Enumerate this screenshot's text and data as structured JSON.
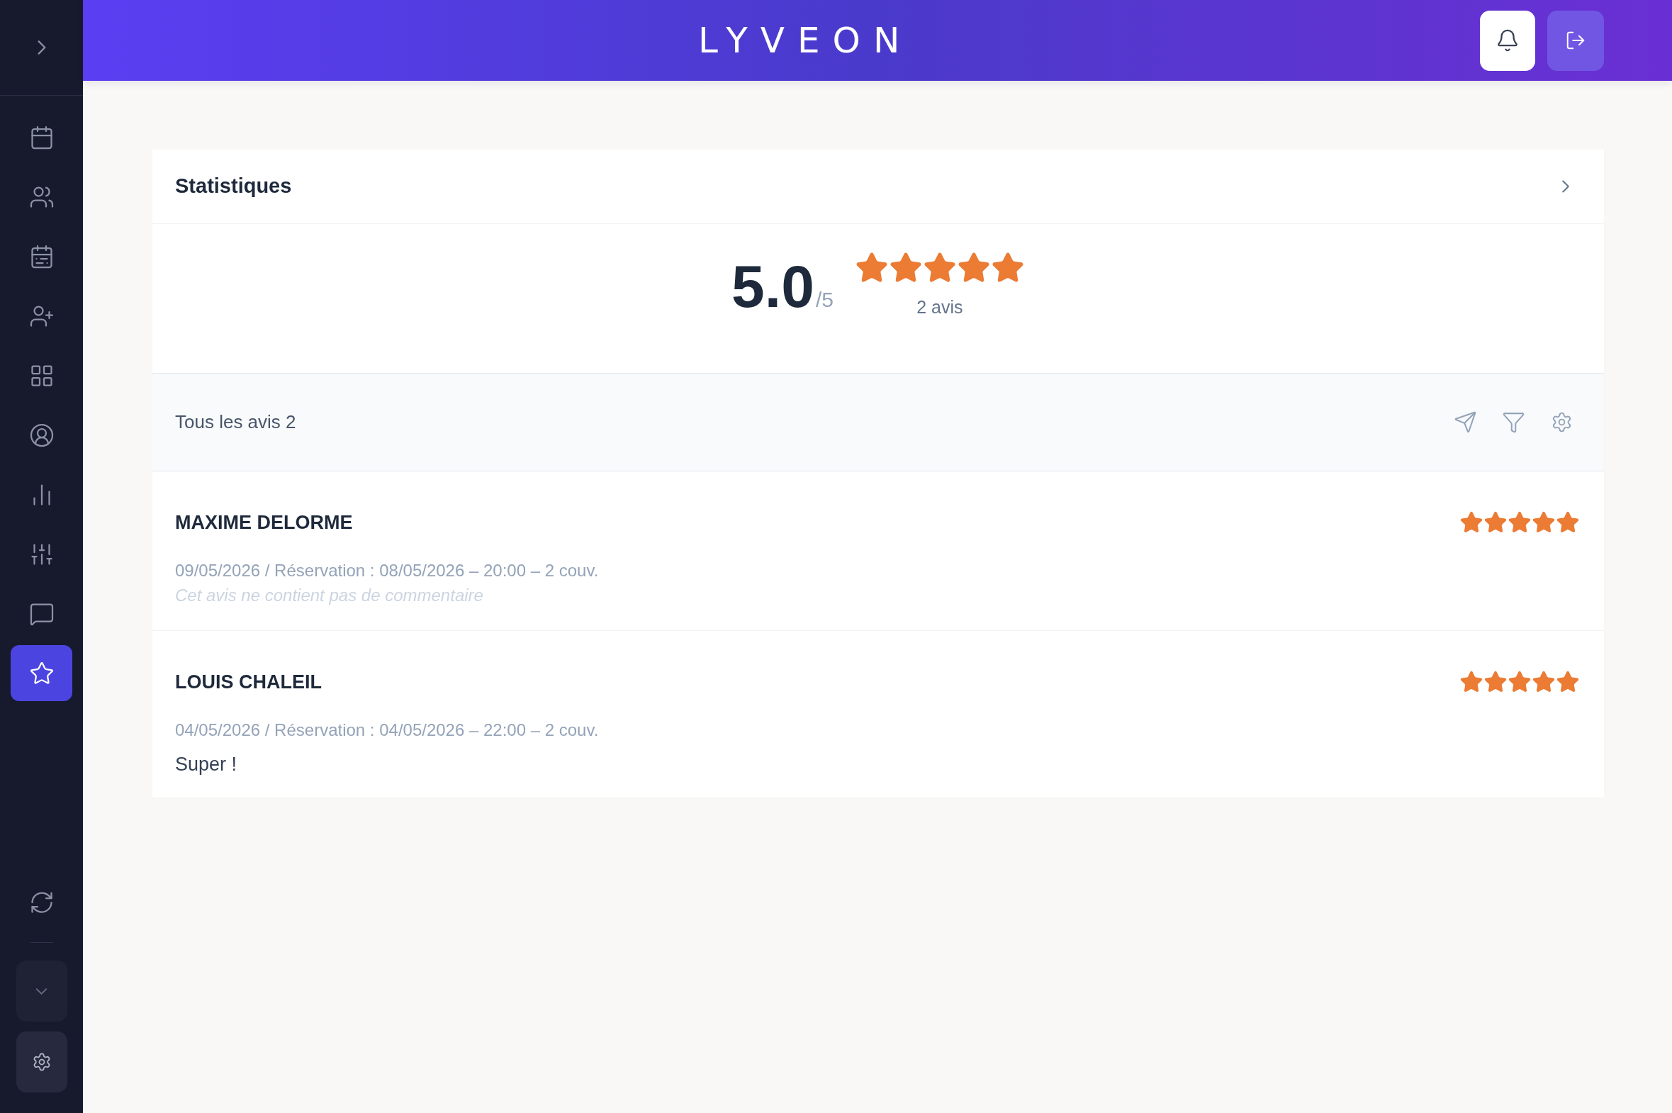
{
  "sidebar": {
    "items": [
      {
        "selected": false
      },
      {
        "selected": false
      },
      {
        "selected": false
      },
      {
        "selected": false
      },
      {
        "selected": false
      },
      {
        "selected": false
      },
      {
        "selected": false
      },
      {
        "selected": false
      },
      {
        "selected": false
      },
      {
        "selected": true
      }
    ]
  },
  "header": {
    "logo": "LYVEON"
  },
  "statistics": {
    "title": "Statistiques",
    "rating": {
      "value": "5.0",
      "scale": "/5",
      "stars": 5,
      "count": "2 avis"
    }
  },
  "reviews": {
    "title": "Tous les avis 2",
    "items": [
      {
        "name": "MAXIME DELORME",
        "stars": 5,
        "meta": "09/05/2026 / Réservation : 08/05/2026 – 20:00 – 2 couv.",
        "comment": "Cet avis ne contient pas de commentaire",
        "comment_missing": true
      },
      {
        "name": "LOUIS CHALEIL",
        "stars": 5,
        "meta": "04/05/2026 / Réservation : 04/05/2026 – 22:00 – 2 couv.",
        "comment": "Super !",
        "comment_missing": false
      }
    ]
  }
}
